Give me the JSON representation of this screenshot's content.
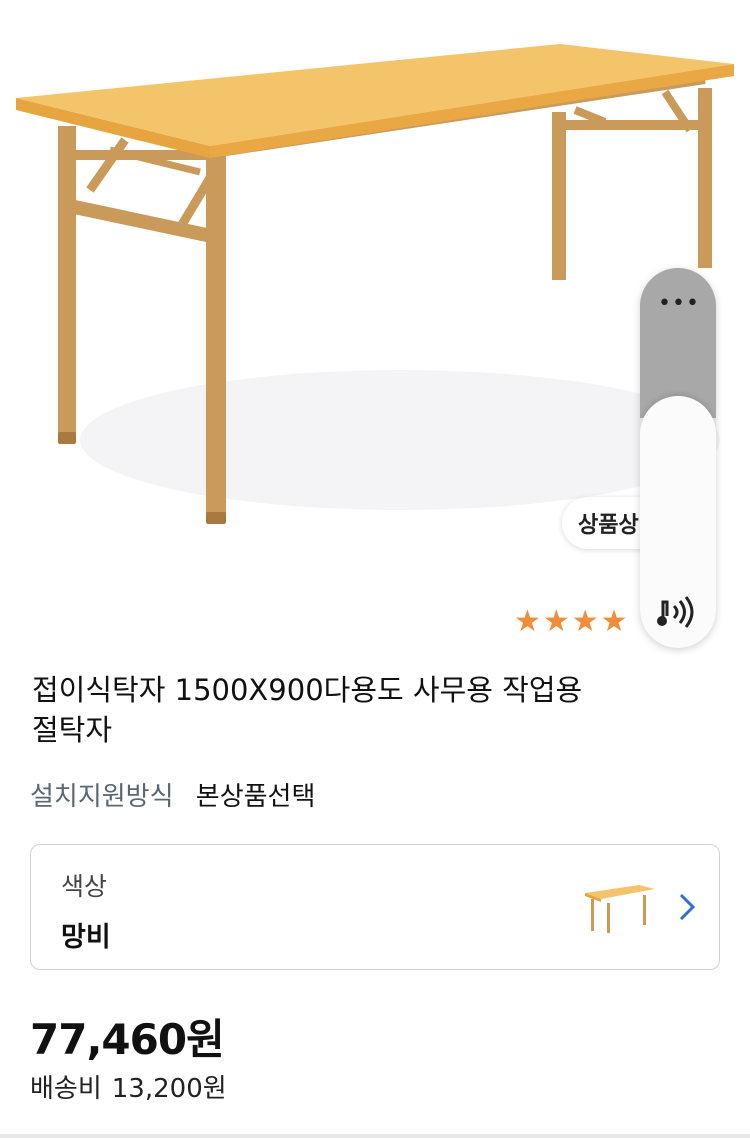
{
  "product": {
    "title_line1": "접이식탁자 1500X900다용도 사무용 작업용",
    "title_line2": "절탁자",
    "option_label": "설치지원방식",
    "option_value": "본상품선택",
    "color_label": "색상",
    "color_value": "망비",
    "price": "77,460원",
    "shipping_label": "배송비",
    "shipping_value": "13,200원"
  },
  "overlay": {
    "pill_label": "상품상",
    "more_icon": "more-horizontal-icon",
    "sound_icon": "speaker-icon"
  },
  "rating": {
    "stars_glyphs": "★★★★",
    "stars_shown": 4
  },
  "colors": {
    "table_top": "#f4c46a",
    "table_edge": "#e6a53e",
    "frame": "#c99a5a",
    "star": "#f28c38",
    "chevron": "#2f6fd6"
  }
}
